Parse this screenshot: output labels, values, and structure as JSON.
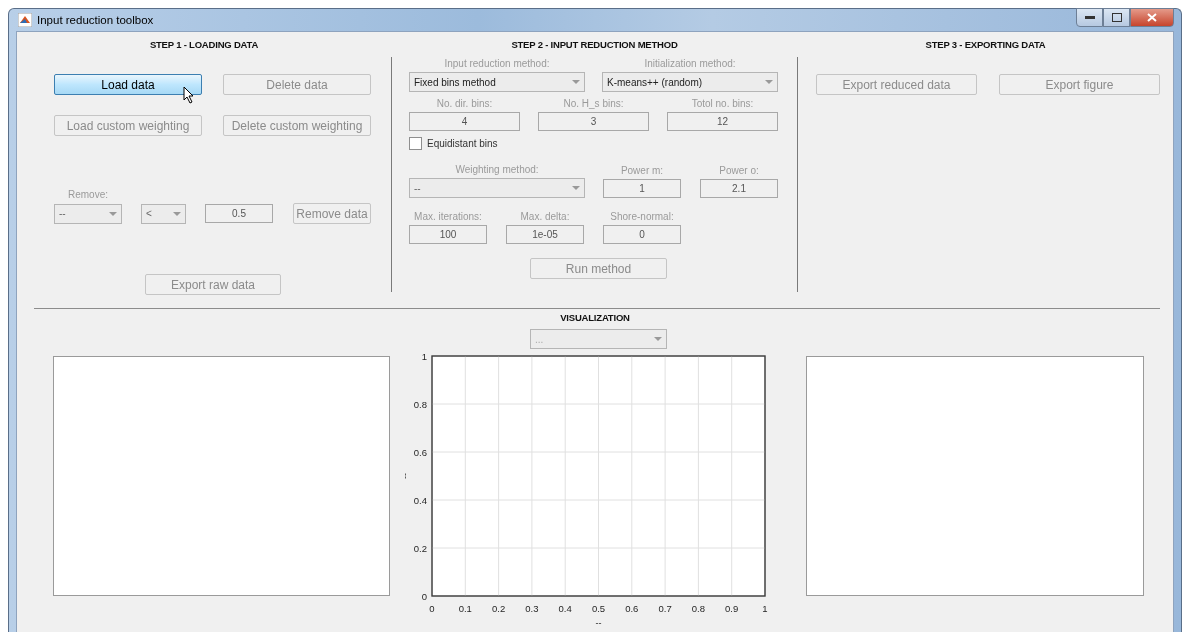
{
  "window": {
    "title": "Input reduction toolbox"
  },
  "step1": {
    "title": "STEP 1 - LOADING DATA",
    "buttons": [
      {
        "label": "Load data",
        "disabled": false,
        "hovered": true
      },
      {
        "label": "Delete data",
        "disabled": true,
        "hovered": false
      },
      {
        "label": "Load custom weighting",
        "disabled": true,
        "hovered": false
      },
      {
        "label": "Delete custom weighting",
        "disabled": true,
        "hovered": false
      }
    ],
    "remove": {
      "label": "Remove:",
      "column_dropdown": "--",
      "operator_dropdown": "<",
      "threshold": "0.5",
      "button": "Remove data"
    },
    "export_button": "Export raw data"
  },
  "step2": {
    "title": "STEP 2 - INPUT REDUCTION METHOD",
    "reduction_method": {
      "label": "Input reduction method:",
      "value": "Fixed bins method"
    },
    "initialization_method": {
      "label": "Initialization method:",
      "value": "K-means++ (random)"
    },
    "bins": [
      {
        "label": "No. dir. bins:",
        "value": "4"
      },
      {
        "label": "No. H_s bins:",
        "value": "3"
      },
      {
        "label": "Totol no. bins:",
        "value": "12"
      }
    ],
    "equidistant": {
      "label": "Equidistant bins",
      "checked": false
    },
    "weighting_method": {
      "label": "Weighting method:",
      "value": "--"
    },
    "powers": [
      {
        "label": "Power m:",
        "value": "1"
      },
      {
        "label": "Power o:",
        "value": "2.1"
      }
    ],
    "limits": [
      {
        "label": "Max. iterations:",
        "value": "100"
      },
      {
        "label": "Max. delta:",
        "value": "1e-05"
      },
      {
        "label": "Shore-normal:",
        "value": "0"
      }
    ],
    "run_button": "Run method"
  },
  "step3": {
    "title": "STEP 3 - EXPORTING DATA",
    "buttons": [
      "Export reduced data",
      "Export figure"
    ]
  },
  "visualization": {
    "title": "VISUALIZATION",
    "dropdown": "...",
    "chart_data": {
      "type": "line",
      "grid": true,
      "xlabel": "--",
      "ylabel": "--",
      "xlim": [
        0,
        1
      ],
      "ylim": [
        0,
        1
      ],
      "xticks": [
        0,
        0.1,
        0.2,
        0.3,
        0.4,
        0.5,
        0.6,
        0.7,
        0.8,
        0.9,
        1
      ],
      "yticks": [
        0,
        0.2,
        0.4,
        0.6,
        0.8,
        1
      ]
    }
  }
}
